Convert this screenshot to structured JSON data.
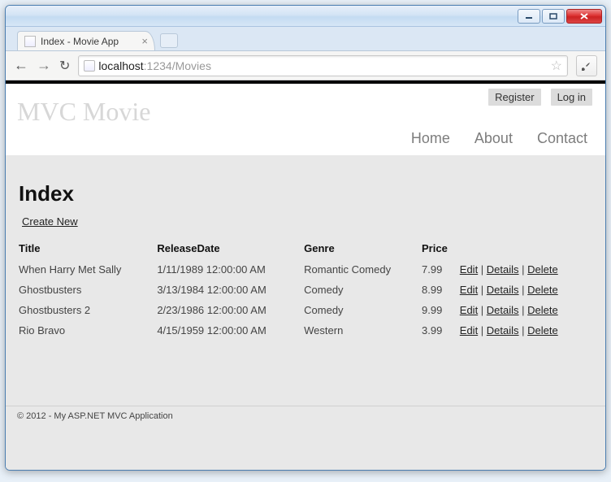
{
  "window": {
    "tab_title": "Index - Movie App",
    "url_host": "localhost",
    "url_port_path": ":1234/Movies"
  },
  "auth": {
    "register": "Register",
    "login": "Log in"
  },
  "brand": "MVC Movie",
  "nav": {
    "home": "Home",
    "about": "About",
    "contact": "Contact"
  },
  "page": {
    "heading": "Index",
    "create": "Create New"
  },
  "table": {
    "headers": {
      "title": "Title",
      "release": "ReleaseDate",
      "genre": "Genre",
      "price": "Price"
    },
    "actions": {
      "edit": "Edit",
      "details": "Details",
      "delete": "Delete"
    },
    "rows": [
      {
        "title": "When Harry Met Sally",
        "release": "1/11/1989 12:00:00 AM",
        "genre": "Romantic Comedy",
        "price": "7.99"
      },
      {
        "title": "Ghostbusters",
        "release": "3/13/1984 12:00:00 AM",
        "genre": "Comedy",
        "price": "8.99"
      },
      {
        "title": "Ghostbusters 2",
        "release": "2/23/1986 12:00:00 AM",
        "genre": "Comedy",
        "price": "9.99"
      },
      {
        "title": "Rio Bravo",
        "release": "4/15/1959 12:00:00 AM",
        "genre": "Western",
        "price": "3.99"
      }
    ]
  },
  "footer": "© 2012 - My ASP.NET MVC Application"
}
